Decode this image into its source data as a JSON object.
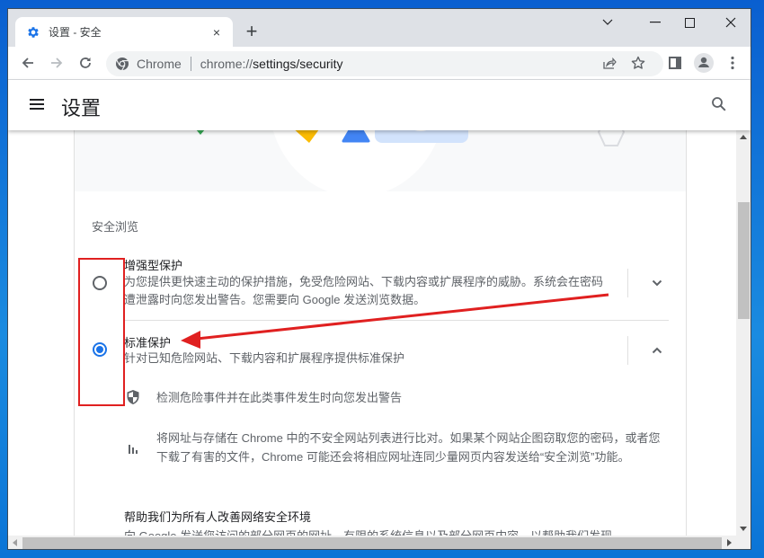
{
  "window": {
    "tab": {
      "title": "设置 - 安全",
      "favicon": "gear-icon",
      "close": "×"
    },
    "new_tab": "+",
    "controls": {
      "tab_search": "⌄",
      "minimize": "—",
      "maximize": "☐",
      "close": "✕"
    }
  },
  "toolbar": {
    "back": "←",
    "forward": "→",
    "reload": "⟳",
    "site_chip": "Chrome",
    "url_prefix": "chrome://",
    "url_path": "settings/security",
    "icons": [
      "share-icon",
      "bookmark-star-icon",
      "side-panel-icon",
      "profile-avatar-icon",
      "more-menu-icon"
    ]
  },
  "settings": {
    "title": "设置",
    "section_label": "安全浏览",
    "options": [
      {
        "title": "增强型保护",
        "description": "为您提供更快速主动的保护措施，免受危险网站、下载内容或扩展程序的威胁。系统会在密码遭泄露时向您发出警告。您需要向 Google 发送浏览数据。",
        "selected": false,
        "expanded": false
      },
      {
        "title": "标准保护",
        "description": "针对已知危险网站、下载内容和扩展程序提供标准保护",
        "selected": true,
        "expanded": true
      }
    ],
    "details": [
      {
        "icon": "shield-icon",
        "text": "检测危险事件并在此类事件发生时向您发出警告"
      },
      {
        "icon": "bar-chart-icon",
        "text": "将网址与存储在 Chrome 中的不安全网站列表进行比对。如果某个网站企图窃取您的密码，或者您下载了有害的文件，Chrome 可能还会将相应网址连同少量网页内容发送给“安全浏览”功能。"
      }
    ],
    "help": {
      "title": "帮助我们为所有人改善网络安全环境",
      "description": "向 Google 发送您访问的部分网页的网址、有限的系统信息以及部分网页内容，以帮助我们发现"
    }
  },
  "colors": {
    "accent": "#1a73e8",
    "annotation": "#e02020",
    "banner_yellow": "#fbbc04",
    "banner_blue": "#4285f4",
    "banner_green": "#34a853",
    "banner_lightblue": "#d2e3fc"
  }
}
